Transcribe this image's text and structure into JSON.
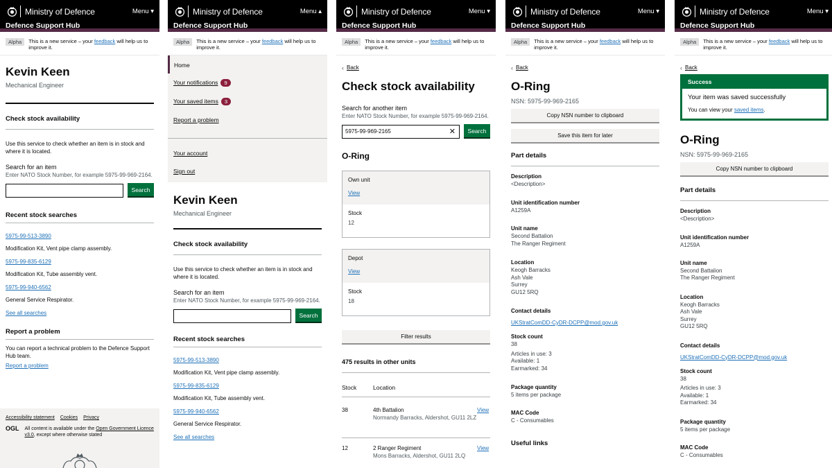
{
  "header": {
    "brand": "Ministry of Defence",
    "menu_closed": "Menu ▾",
    "menu_open": "Menu ▴",
    "hub": "Defence Support Hub"
  },
  "phase": {
    "tag": "Alpha",
    "pre": "This is a new service – your ",
    "link": "feedback",
    "post": " will help us to improve it."
  },
  "back": "Back",
  "colors": {
    "header": "#000000",
    "accent": "#532a45",
    "green": "#00703c",
    "badge": "#8b1f3c",
    "link": "#1d70b8"
  },
  "profile": {
    "name": "Kevin Keen",
    "role": "Mechanical Engineer"
  },
  "home": {
    "check_heading": "Check stock availability",
    "check_desc": "Use this service to check whether an item is in stock and where it is located.",
    "search_label": "Search for an item",
    "search_hint": "Enter NATO Stock Number, for example 5975-99-969-2164.",
    "search_button": "Search",
    "recent_heading": "Recent stock searches",
    "recent": [
      {
        "nsn": "5975-99-513-3890",
        "desc": "Modification Kit, Vent pipe clamp assembly."
      },
      {
        "nsn": "5975-99-835-6129",
        "desc": "Modification Kit, Tube assembly vent."
      },
      {
        "nsn": "5975-99-940-6562",
        "desc": "General Service Respirator."
      }
    ],
    "see_all": "See all searches",
    "report_heading": "Report a problem",
    "report_desc": "You can report a technical problem to the Defence Support Hub team.",
    "report_link": "Report a problem"
  },
  "footer": {
    "links": [
      "Accessibility statement",
      "Cookies",
      "Privacy"
    ],
    "ogl": "OGL",
    "licence_pre": "All content is available under the ",
    "licence_link": "Open Government Licence v3.0",
    "licence_post": ", except where otherwise stated"
  },
  "menu": {
    "home": "Home",
    "notifications": "Your notifications",
    "notifications_count": "9",
    "saved": "Your saved items",
    "saved_count": "3",
    "report": "Report a problem",
    "account": "Your account",
    "signout": "Sign out"
  },
  "check": {
    "title": "Check stock availability",
    "search_label": "Search for another item",
    "search_hint": "Enter NATO Stock Number, for example 5975-99-969-2164.",
    "search_value": "5975-99-969-2165",
    "search_button": "Search",
    "item_title": "O-Ring",
    "own_unit": "Own unit",
    "depot": "Depot",
    "view": "View",
    "stock_label": "Stock",
    "own_stock": "12",
    "depot_stock": "18",
    "filter": "Filter results",
    "other_units": "475 results in other units",
    "col_stock": "Stock",
    "col_location": "Location",
    "rows": [
      {
        "stock": "38",
        "unit": "4th Battalion",
        "place": "Normandy Barracks, Aldershot, GU11 2LZ"
      },
      {
        "stock": "12",
        "unit": "2 Ranger Regiment",
        "place": "Mons Barracks, Aldershot, GU11 2LQ"
      }
    ]
  },
  "item": {
    "title": "O-Ring",
    "nsn": "NSN: 5975-99-969-2165",
    "copy": "Copy NSN number to clipboard",
    "save": "Save this item for later",
    "part_details": "Part details",
    "fields": {
      "description_k": "Description",
      "description_v": "<Description>",
      "uin_k": "Unit identification number",
      "uin_v": "A1259A",
      "unit_k": "Unit name",
      "unit_v1": "Second Battalion",
      "unit_v2": "The Ranger Regiment",
      "loc_k": "Location",
      "loc_v1": "Keogh Barracks",
      "loc_v2": "Ash Vale",
      "loc_v3": "Surrey",
      "loc_v4": "GU12 5RQ",
      "contact_k": "Contact details",
      "contact_v": "UKStratComDD-CyDR-DCPP@mod.gov.uk",
      "stock_k": "Stock count",
      "stock_v": "38",
      "in_use": "Articles in use: 3",
      "available": "Available: 1",
      "earmarked": "Earmarked: 34",
      "package_k": "Package quantity",
      "package_v": "5 items per package",
      "mac_k": "MAC Code",
      "mac_v": "C - Consumables"
    },
    "useful_links": "Useful links"
  },
  "success": {
    "heading": "Success",
    "message": "Your item was saved successfully",
    "view_pre": "You can view your ",
    "view_link": "saved items",
    "view_post": "."
  }
}
